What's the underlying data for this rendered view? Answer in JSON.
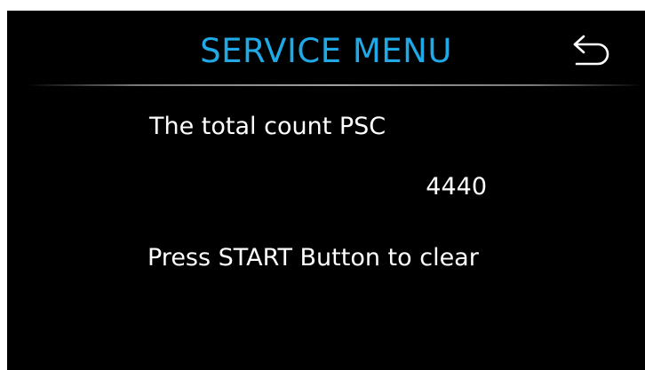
{
  "header": {
    "title": "SERVICE MENU",
    "back_icon": "back-arrow-icon",
    "accent_color": "#1fa9e6"
  },
  "content": {
    "label": "The total count PSC",
    "count": "4440",
    "instruction": "Press START Button to clear"
  }
}
